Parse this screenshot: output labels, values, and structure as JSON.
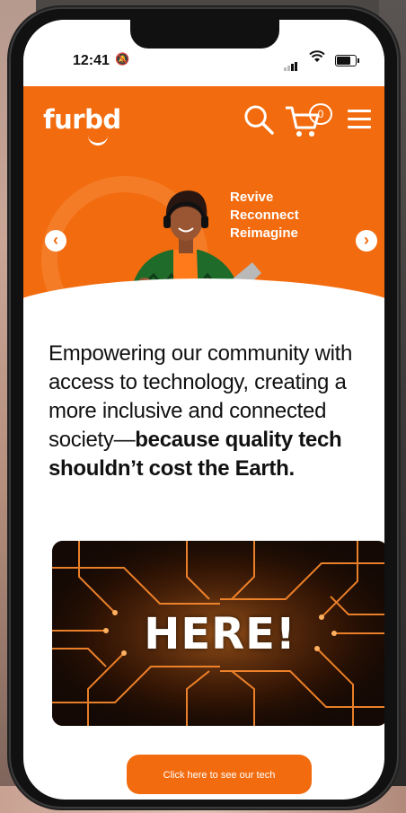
{
  "status_bar": {
    "time": "12:41"
  },
  "header": {
    "logo_text": "furbd",
    "cart_count": "0"
  },
  "hero": {
    "lines": [
      "Revive",
      "Reconnect",
      "Reimagine"
    ]
  },
  "intro": {
    "text": "Empowering our community with access to technology, creating a more inclusive and connected society—",
    "bold_text": "because quality tech shouldn’t cost the Earth."
  },
  "video": {
    "headline": "HERE!"
  },
  "cta": {
    "label": "Click here to see our tech"
  },
  "colors": {
    "brand_orange": "#f26c0f",
    "background": "#ffffff"
  },
  "icons": [
    "bell-slash-icon",
    "signal-icon",
    "wifi-icon",
    "battery-icon",
    "search-icon",
    "cart-icon",
    "menu-icon",
    "chevron-left-icon",
    "chevron-right-icon"
  ]
}
